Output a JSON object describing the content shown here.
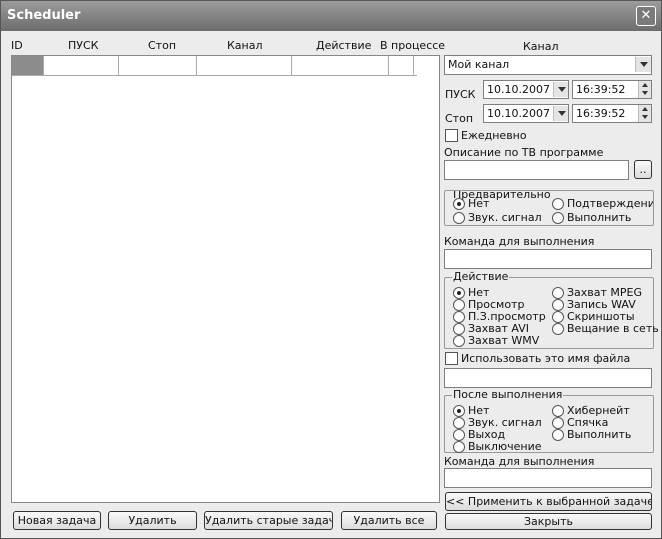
{
  "window": {
    "title": "Scheduler"
  },
  "grid": {
    "columns": [
      "ID",
      "ПУСК",
      "Стоп",
      "Канал",
      "Действие",
      "В процессе"
    ]
  },
  "buttons": {
    "new_task": "Новая задача",
    "delete": "Удалить",
    "delete_old": "Удалить старые задачи",
    "delete_all": "Удалить все",
    "apply": "<< Применить к выбранной задаче",
    "close": "Закрыть",
    "browse": ".."
  },
  "right": {
    "channel_label": "Канал",
    "channel_value": "Мой канал",
    "start_label": "ПУСК",
    "start_date": "10.10.2007",
    "start_time": "16:39:52",
    "stop_label": "Стоп",
    "stop_date": "10.10.2007",
    "stop_time": "16:39:52",
    "daily_label": "Ежедневно",
    "tv_desc_label": "Описание по ТВ программе",
    "tv_desc_value": "",
    "pre": {
      "label": "Предварительно",
      "options": [
        "Нет",
        "Подтверждение",
        "Звук. сигнал",
        "Выполнить"
      ],
      "selected": "Нет"
    },
    "cmd1_label": "Команда для выполнения",
    "cmd1_value": "",
    "action": {
      "label": "Действие",
      "options": [
        "Нет",
        "Захват MPEG",
        "Просмотр",
        "Запись WAV",
        "П.З.просмотр",
        "Скриншоты",
        "Захват AVI",
        "Вещание в сеть",
        "Захват WMV"
      ],
      "selected": "Нет"
    },
    "use_filename_label": "Использовать это имя файла",
    "filename_value": "",
    "after": {
      "label": "После выполнения",
      "options": [
        "Нет",
        "Хибернейт",
        "Звук. сигнал",
        "Спячка",
        "Выход",
        "Выполнить",
        "Выключение"
      ],
      "selected": "Нет"
    },
    "cmd2_label": "Команда для выполнения",
    "cmd2_value": ""
  }
}
